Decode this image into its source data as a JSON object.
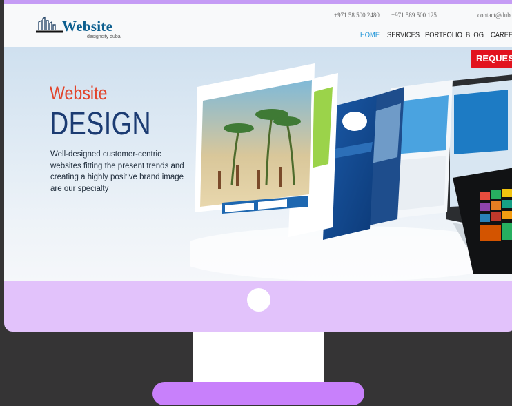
{
  "brand": {
    "name": "Website",
    "tagline": "designcity dubai"
  },
  "contacts": {
    "phone1": "+971 58 500 2480",
    "phone2": "+971 589 500 125",
    "email": "contact@dub"
  },
  "nav": {
    "items": [
      "HOME",
      "SERVICES",
      "PORTFOLIO",
      "BLOG",
      "CAREER"
    ],
    "active": "HOME"
  },
  "cta": {
    "label": "REQUEST"
  },
  "hero": {
    "title_small": "Website",
    "title_large": "DESIGN",
    "description": "Well-designed customer-centric websites fitting the present trends and creating a highly positive brand image are our specialty"
  },
  "colors": {
    "background": "#353435",
    "monitor": "#e2c2fb",
    "stand_base": "#c880fb",
    "accent_blue": "#1590d6",
    "accent_red": "#e2131e",
    "title_orange": "#e2432a",
    "title_navy": "#1b3b72"
  }
}
